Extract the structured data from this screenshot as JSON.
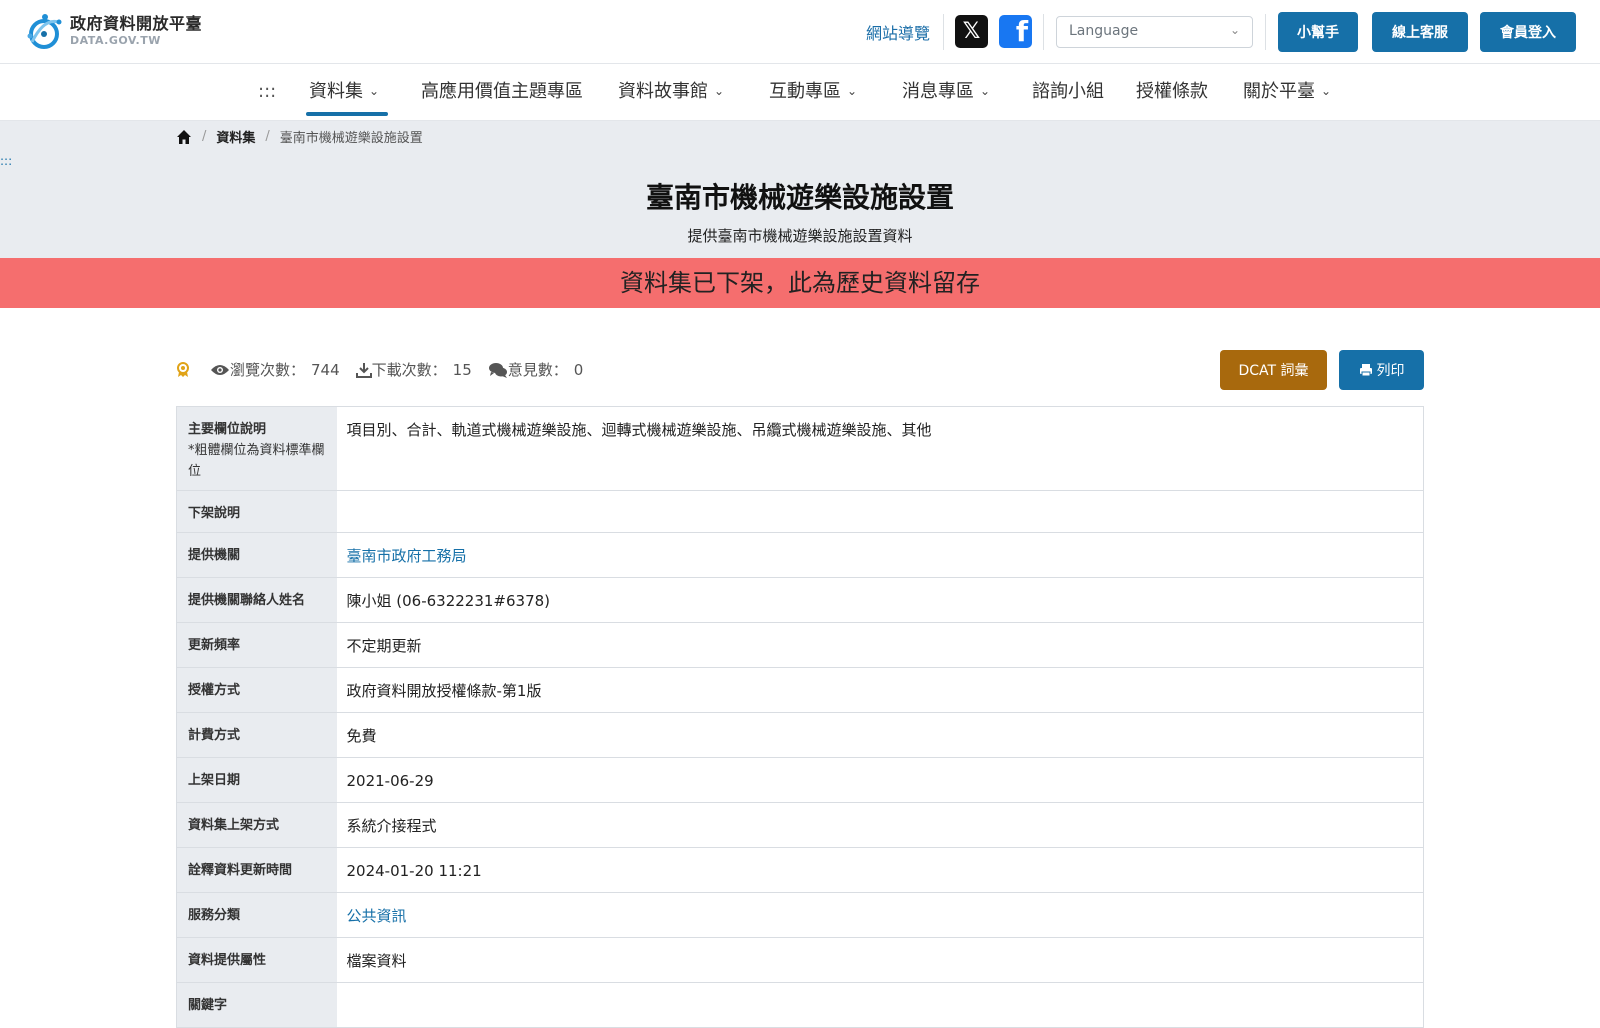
{
  "header": {
    "logo_title": "政府資料開放平臺",
    "logo_sub": "DATA.GOV.TW",
    "sitemap": "網站導覽",
    "x_icon": "x-icon",
    "fb_icon": "facebook-icon",
    "language_placeholder": "Language",
    "helper_button": "小幫手",
    "support_button": "線上客服",
    "login_button": "會員登入"
  },
  "nav": {
    "accesskey": ":::",
    "items": [
      {
        "label": "資料集",
        "dropdown": true
      },
      {
        "label": "高應用價值主題專區",
        "dropdown": false
      },
      {
        "label": "資料故事館",
        "dropdown": true
      },
      {
        "label": "互動專區",
        "dropdown": true
      },
      {
        "label": "消息專區",
        "dropdown": true
      },
      {
        "label": "諮詢小組",
        "dropdown": false
      },
      {
        "label": "授權條款",
        "dropdown": false
      },
      {
        "label": "關於平臺",
        "dropdown": true
      }
    ]
  },
  "breadcrumb": {
    "home_icon": "home-icon",
    "dataset": "資料集",
    "current": "臺南市機械遊樂設施設置"
  },
  "hero": {
    "accesskey": ":::",
    "title": "臺南市機械遊樂設施設置",
    "subtitle": "提供臺南市機械遊樂設施設置資料"
  },
  "banner": "資料集已下架，此為歷史資料留存",
  "stats": {
    "views_label": "瀏覽次數：",
    "views": "744",
    "downloads_label": "下載次數：",
    "downloads": "15",
    "comments_label": "意見數：",
    "comments": "0"
  },
  "actions": {
    "dcat": "DCAT 詞彙",
    "print": "列印"
  },
  "details": {
    "main_fields_label": "主要欄位說明",
    "main_fields_note": "*粗體欄位為資料標準欄位",
    "main_fields": "項目別、合計、軌道式機械遊樂設施、迴轉式機械遊樂設施、吊纜式機械遊樂設施、其他",
    "rows": [
      {
        "key": "下架說明",
        "value": ""
      },
      {
        "key": "提供機關",
        "value": "臺南市政府工務局",
        "link": true
      },
      {
        "key": "提供機關聯絡人姓名",
        "value": "陳小姐 (06-6322231#6378)"
      },
      {
        "key": "更新頻率",
        "value": "不定期更新"
      },
      {
        "key": "授權方式",
        "value": "政府資料開放授權條款-第1版"
      },
      {
        "key": "計費方式",
        "value": "免費"
      },
      {
        "key": "上架日期",
        "value": "2021-06-29"
      },
      {
        "key": "資料集上架方式",
        "value": "系統介接程式"
      },
      {
        "key": "詮釋資料更新時間",
        "value": "2024-01-20 11:21"
      },
      {
        "key": "服務分類",
        "value": "公共資訊",
        "link": true
      },
      {
        "key": "資料提供屬性",
        "value": "檔案資料"
      },
      {
        "key": "關鍵字",
        "value": ""
      }
    ]
  }
}
